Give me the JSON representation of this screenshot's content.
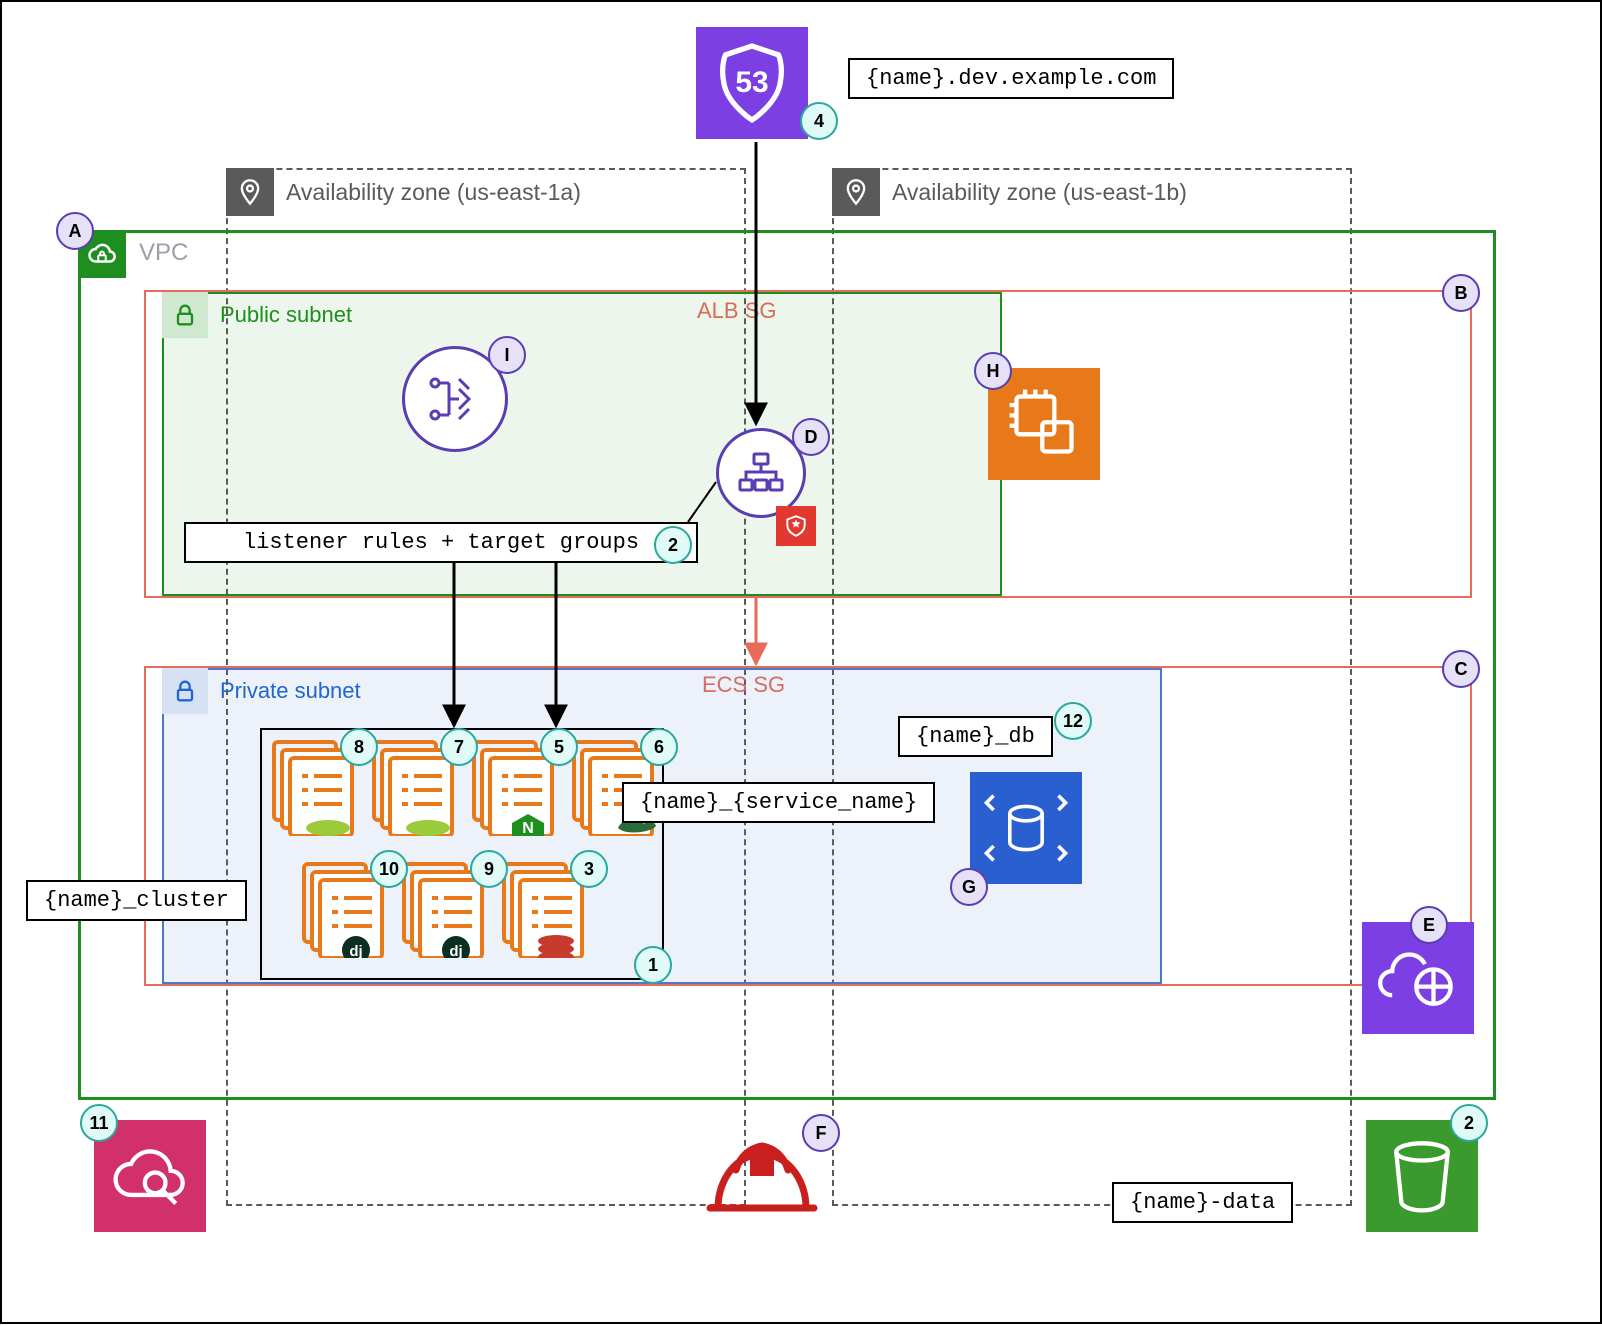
{
  "route53": {
    "domain_label": "{name}.dev.example.com",
    "badge": "4"
  },
  "az": {
    "a": "Availability zone (us-east-1a)",
    "b": "Availability zone (us-east-1b)"
  },
  "vpc": {
    "label": "VPC",
    "badge": "A"
  },
  "public_subnet": {
    "label": "Public subnet"
  },
  "alb_sg_label": "ALB SG",
  "alb_sg_badge": "B",
  "listener_label": "listener rules + target groups",
  "listener_badge": "2",
  "alb_badge": "D",
  "ecs_sg_label": "ECS SG",
  "ecs_sg_badge": "C",
  "private_subnet": {
    "label": "Private subnet"
  },
  "cluster_label": "{name}_cluster",
  "cluster_badge": "1",
  "service_label": "{name}_{service_name}",
  "db_label": "{name}_db",
  "db_badge": "12",
  "rds_badge": "G",
  "cloudmap_badge": "E",
  "compute_badge": "H",
  "alb_listener_badge": "I",
  "cloudwatch_badge": "11",
  "iam_badge": "F",
  "s3_label": "{name}-data",
  "s3_badge": "2",
  "tasks": {
    "redis": "3",
    "nginx": "5",
    "gunicorn": "6",
    "celery_a": "7",
    "celery_b": "8",
    "dj_a": "9",
    "dj_b": "10"
  }
}
